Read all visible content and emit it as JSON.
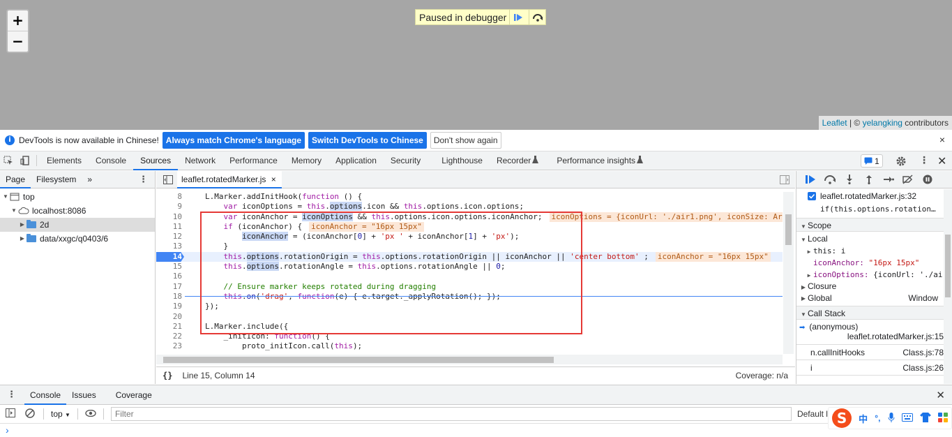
{
  "map": {
    "zoom_in": "+",
    "zoom_out": "−",
    "paused_text": "Paused in debugger",
    "attribution": {
      "leaflet": "Leaflet",
      "sep": "| ©",
      "author": "yelangking",
      "suffix": "contributors"
    }
  },
  "infobar": {
    "message": "DevTools is now available in Chinese!",
    "btn_match": "Always match Chrome's language",
    "btn_switch": "Switch DevTools to Chinese",
    "btn_dont": "Don't show again",
    "close": "×"
  },
  "tabs": [
    "Elements",
    "Console",
    "Sources",
    "Network",
    "Performance",
    "Memory",
    "Application",
    "Security",
    "Lighthouse",
    "Recorder",
    "Performance insights"
  ],
  "issues_count": "1",
  "navigator": {
    "tab_page": "Page",
    "tab_fs": "Filesystem",
    "more": "»",
    "tree": [
      "top",
      "localhost:8086",
      "2d",
      "data/xxgc/q0403/6"
    ]
  },
  "editor": {
    "file_tab": "leaflet.rotatedMarker.js",
    "close": "×",
    "status_pos": "Line 15, Column 14",
    "coverage": "Coverage: n/a",
    "format": "{}"
  },
  "code": {
    "line_numbers": [
      "8",
      "9",
      "10",
      "11",
      "12",
      "13",
      "14",
      "15",
      "16",
      "17",
      "18",
      "19",
      "20",
      "21",
      "22",
      "23"
    ],
    "inline_values": {
      "l10": "iconOptions = {iconUrl: './air1.png', iconSize: Ar",
      "l11": "iconAnchor = \"16px 15px\"",
      "l14": "iconAnchor = \"16px 15px\""
    }
  },
  "debugger": {
    "breakpoint_file": "leaflet.rotatedMarker.js:32",
    "breakpoint_code": "if(this.options.rotation…",
    "scope_title": "Scope",
    "local": "Local",
    "this_label": "this: i",
    "icon_anchor_key": "iconAnchor:",
    "icon_anchor_val": "\"16px 15px\"",
    "icon_options_key": "iconOptions:",
    "icon_options_val": "{iconUrl: './ai",
    "closure": "Closure",
    "global": "Global",
    "global_val": "Window",
    "callstack_title": "Call Stack",
    "frames": [
      {
        "name": "(anonymous)",
        "loc": "leaflet.rotatedMarker.js:15"
      },
      {
        "name": "n.callInitHooks",
        "loc": "Class.js:78"
      },
      {
        "name": "i",
        "loc": "Class.js:26"
      }
    ]
  },
  "console": {
    "tab_console": "Console",
    "tab_issues": "Issues",
    "tab_coverage": "Coverage",
    "context": "top",
    "filter_placeholder": "Filter",
    "levels": "Default le",
    "prompt": "›"
  },
  "ime": {
    "logo": "S",
    "zh": "中",
    "punct": "°,"
  }
}
